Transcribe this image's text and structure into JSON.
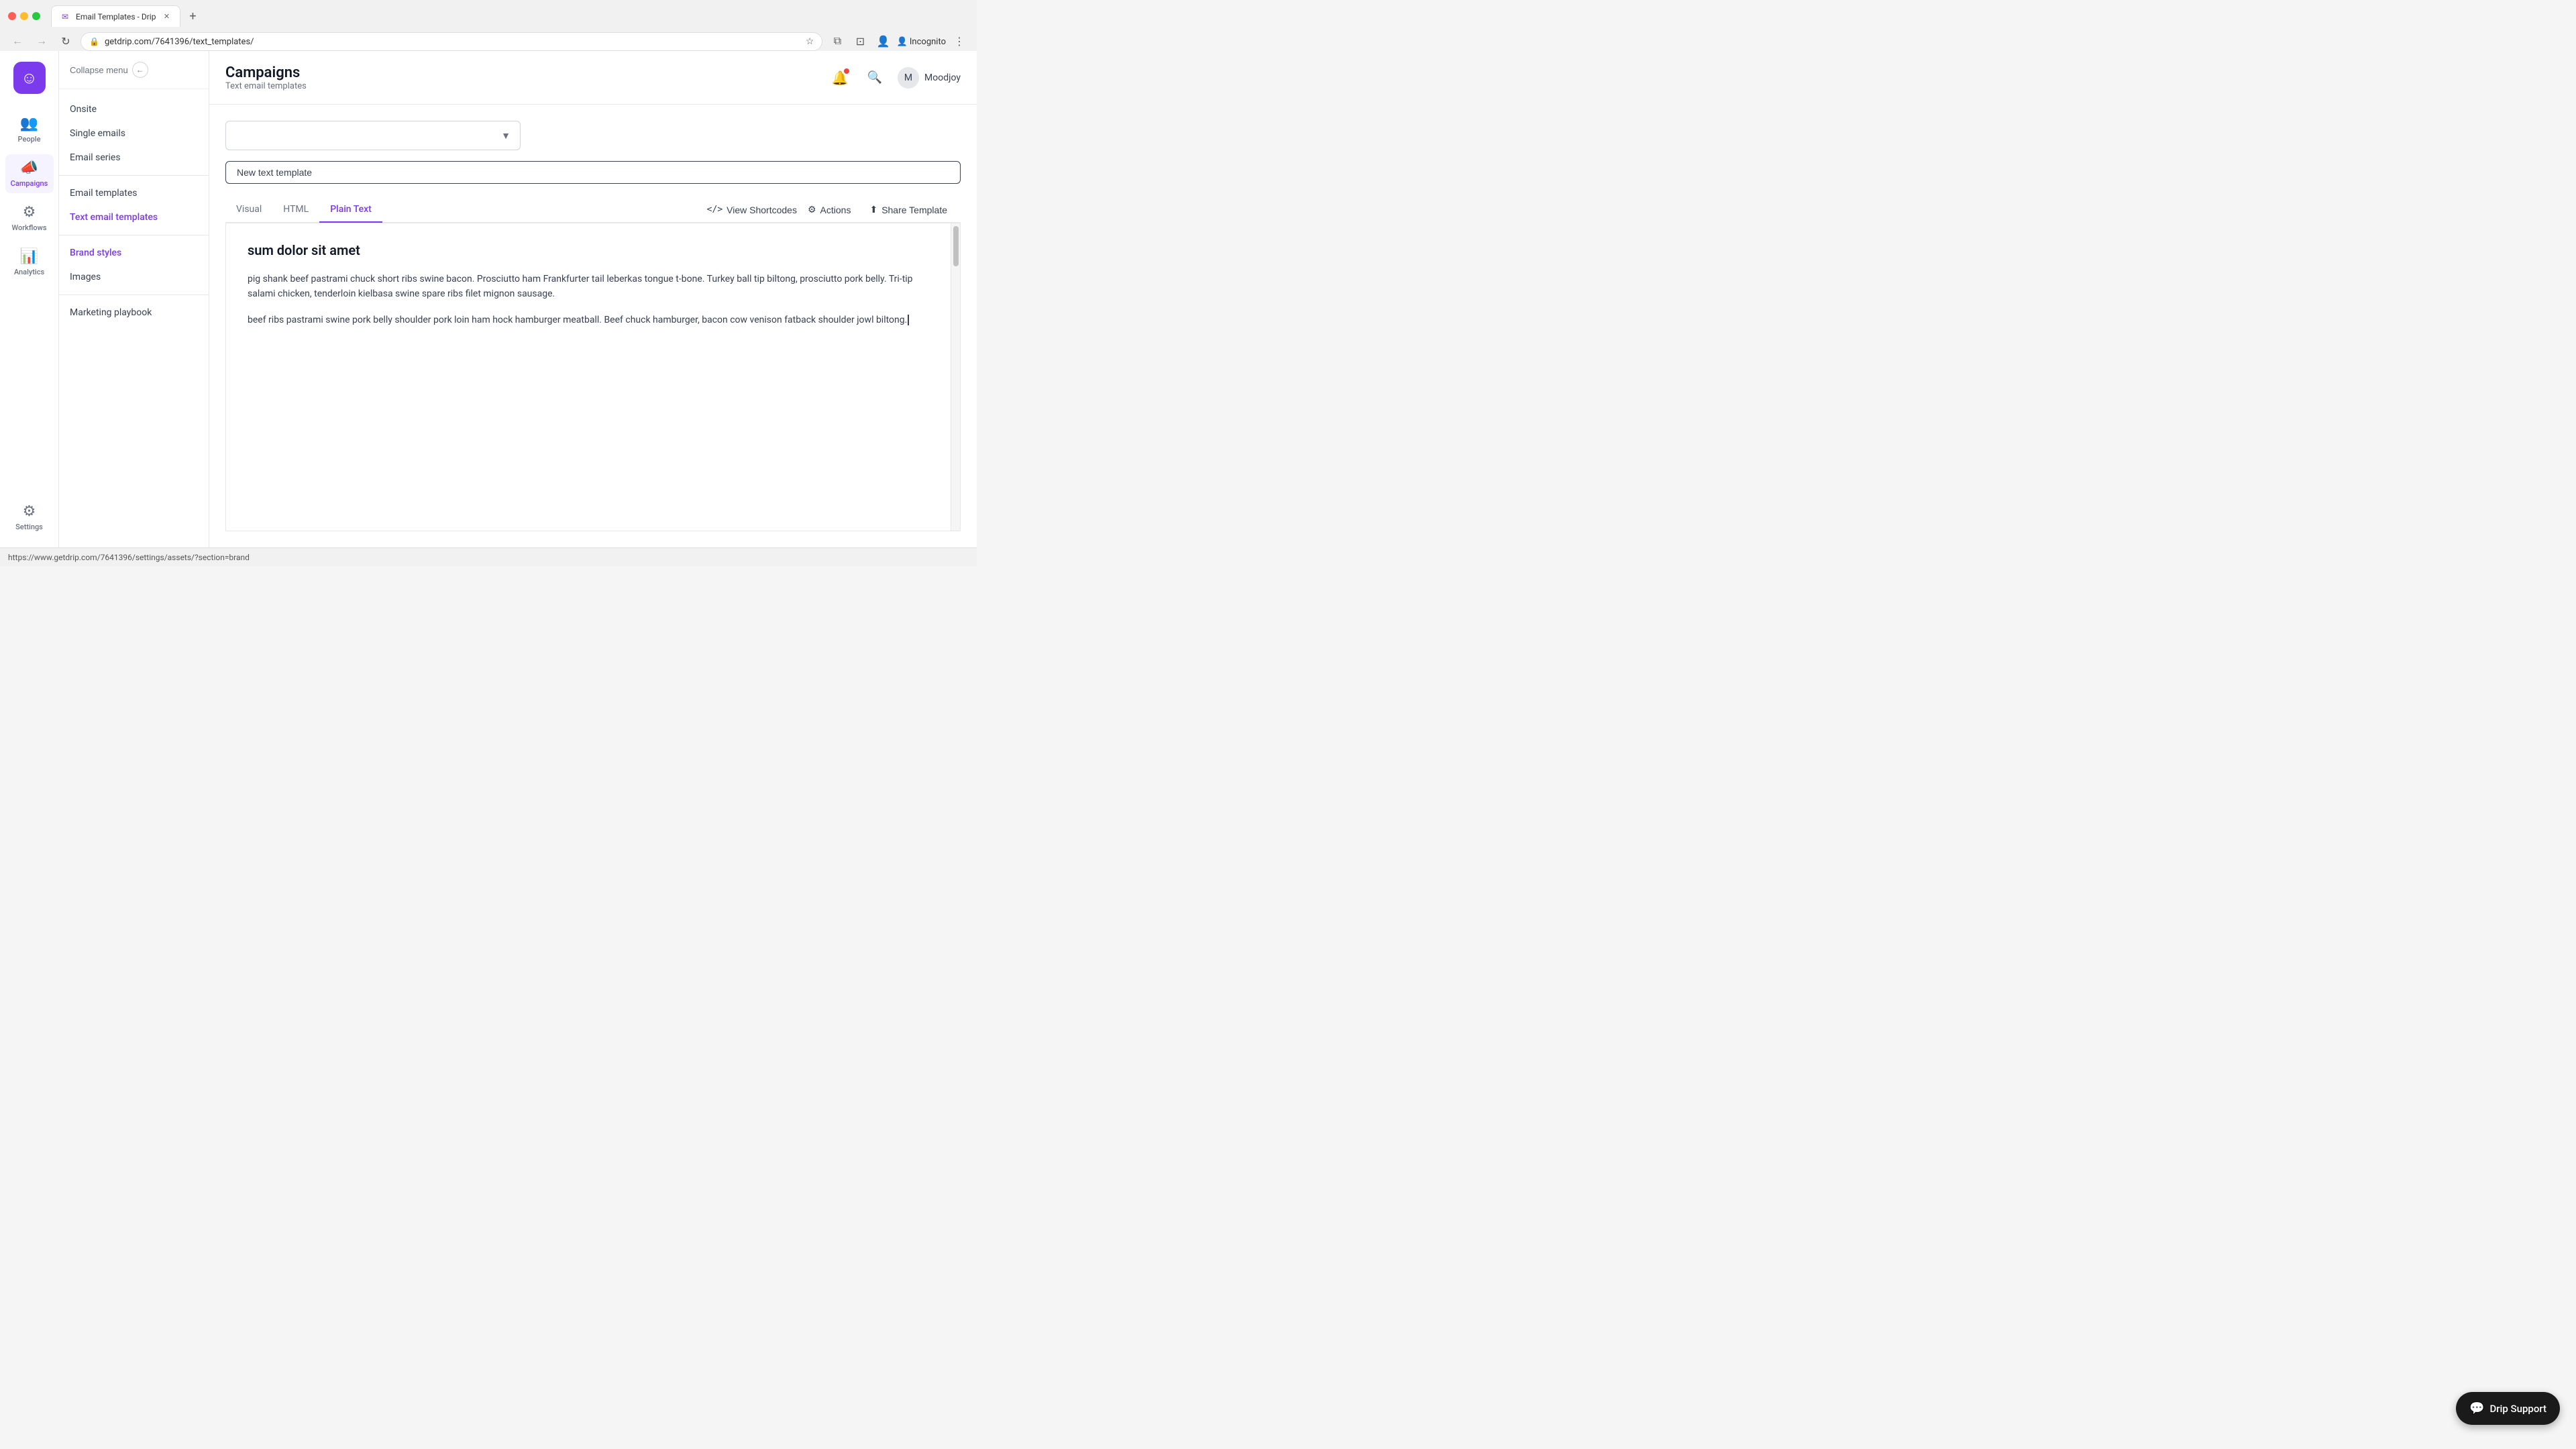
{
  "browser": {
    "tab_title": "Email Templates - Drip",
    "tab_favicon": "✉",
    "url": "getdrip.com/7641396/text_templates/",
    "new_tab_label": "+",
    "nav": {
      "back": "←",
      "forward": "→",
      "refresh": "↻"
    },
    "actions": {
      "bookmark": "☆",
      "profile": "👤 Incognito",
      "menu": "⋮",
      "extensions": "⧉",
      "zoom": "⊡"
    }
  },
  "icon_rail": {
    "logo_icon": "☺",
    "items": [
      {
        "id": "people",
        "label": "People",
        "icon": "👥"
      },
      {
        "id": "campaigns",
        "label": "Campaigns",
        "icon": "📣"
      },
      {
        "id": "workflows",
        "label": "Workflows",
        "icon": "⚙"
      },
      {
        "id": "analytics",
        "label": "Analytics",
        "icon": "📊"
      }
    ],
    "settings": {
      "label": "Settings",
      "icon": "⚙"
    }
  },
  "sidebar": {
    "collapse_label": "Collapse menu",
    "items": [
      {
        "id": "onsite",
        "label": "Onsite"
      },
      {
        "id": "single-emails",
        "label": "Single emails"
      },
      {
        "id": "email-series",
        "label": "Email series"
      },
      {
        "id": "email-templates",
        "label": "Email templates"
      },
      {
        "id": "text-email-templates",
        "label": "Text email templates",
        "active": true
      },
      {
        "id": "brand-styles",
        "label": "Brand styles",
        "highlighted": true
      },
      {
        "id": "images",
        "label": "Images"
      },
      {
        "id": "marketing-playbook",
        "label": "Marketing playbook"
      }
    ]
  },
  "header": {
    "page_title": "Campaigns",
    "breadcrumb": "Text email templates",
    "notification_icon": "🔔",
    "search_icon": "🔍",
    "user": {
      "name": "Moodjoy",
      "avatar": "M"
    }
  },
  "content": {
    "dropdown": {
      "placeholder": "",
      "chevron": "▼"
    },
    "new_template_btn": "New text template",
    "tabs": [
      {
        "id": "visual",
        "label": "Visual"
      },
      {
        "id": "html",
        "label": "HTML"
      },
      {
        "id": "plain-text",
        "label": "Plain Text",
        "active": true
      }
    ],
    "toolbar": {
      "view_shortcodes": "View Shortcodes",
      "view_shortcodes_icon": "</>",
      "actions": "Actions",
      "actions_icon": "⚙",
      "share_template": "Share Template",
      "share_icon": "⬆"
    },
    "editor": {
      "heading": "sum dolor sit amet",
      "paragraph1": "pig shank beef pastrami chuck short ribs swine bacon. Prosciutto ham Frankfurter tail leberkas tongue t-bone. Turkey ball tip biltong, prosciutto pork belly. Tri-tip salami chicken, tenderloin kielbasa swine spare ribs filet mignon sausage.",
      "paragraph2": "beef ribs pastrami swine pork belly shoulder pork loin ham hock hamburger meatball. Beef chuck hamburger, bacon cow venison fatback shoulder jowl biltong."
    }
  },
  "status_bar": {
    "url": "https://www.getdrip.com/7641396/settings/assets/?section=brand"
  },
  "support_btn": {
    "label": "Drip Support",
    "icon": "💬"
  }
}
